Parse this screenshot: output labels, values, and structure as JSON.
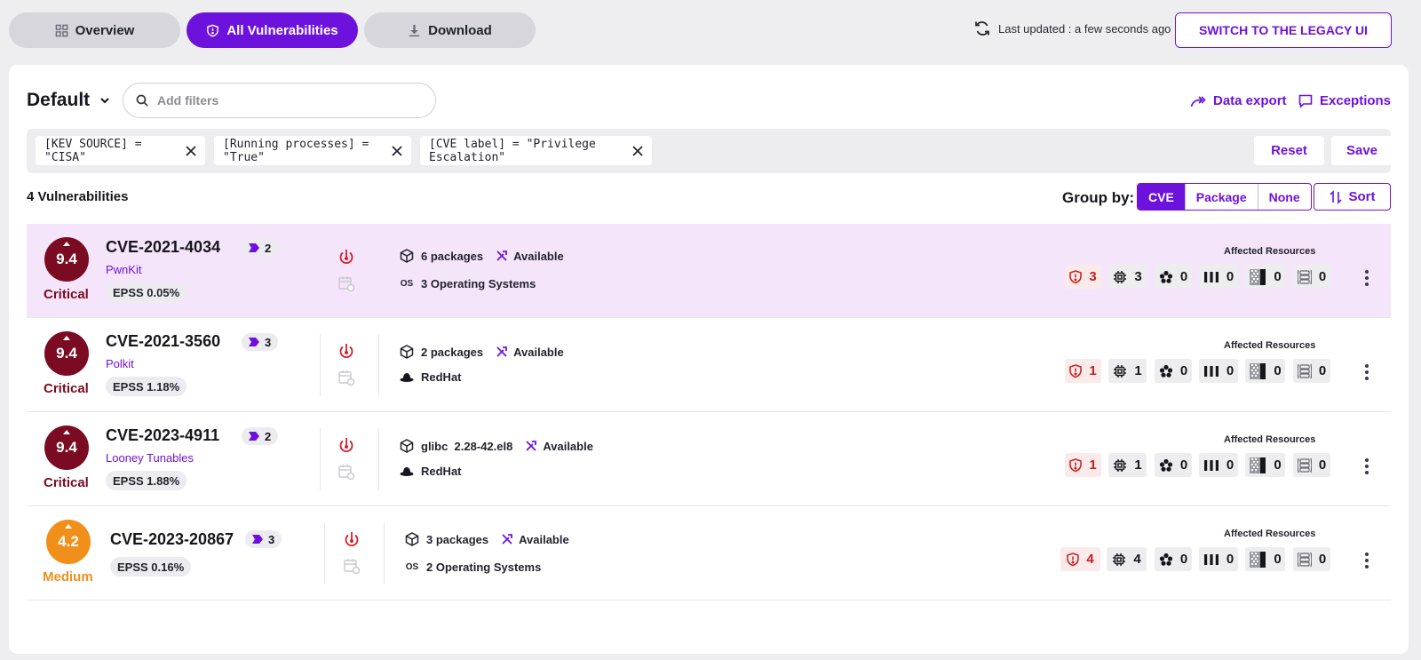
{
  "nav": {
    "overview_label": "Overview",
    "all_vulns_label": "All Vulnerabilities",
    "download_label": "Download",
    "last_updated": "Last updated : a few seconds ago",
    "legacy_label": "SWITCH TO THE LEGACY UI"
  },
  "toolbar": {
    "view_name": "Default",
    "search_placeholder": "Add filters",
    "data_export_label": "Data export",
    "exceptions_label": "Exceptions"
  },
  "filters": {
    "chips": [
      "[KEV SOURCE] = \"CISA\"",
      "[Running processes] = \"True\"",
      "[CVE label] = \"Privilege Escalation\""
    ],
    "reset_label": "Reset",
    "save_label": "Save"
  },
  "summary": {
    "count_label": "4 Vulnerabilities",
    "group_by_label": "Group by:",
    "group_options": [
      "CVE",
      "Package",
      "None"
    ],
    "group_selected": "CVE",
    "sort_label": "Sort"
  },
  "colors": {
    "accent": "#6d12dc",
    "critical": "#7a0b22",
    "medium": "#f0901a",
    "highlight_row": "#f5e5fb"
  },
  "affected_label": "Affected Resources",
  "rows": [
    {
      "score": "9.4",
      "severity": "Critical",
      "cve": "CVE-2021-4034",
      "tag_count": "2",
      "alias": "PwnKit",
      "epss": "EPSS 0.05%",
      "packages": "6 packages",
      "fix": "Available",
      "os_prefix": "OS",
      "os": "3 Operating Systems",
      "counts": [
        "3",
        "3",
        "0",
        "0",
        "0",
        "0"
      ]
    },
    {
      "score": "9.4",
      "severity": "Critical",
      "cve": "CVE-2021-3560",
      "tag_count": "3",
      "alias": "Polkit",
      "epss": "EPSS 1.18%",
      "packages": "2 packages",
      "fix": "Available",
      "os": "RedHat",
      "counts": [
        "1",
        "1",
        "0",
        "0",
        "0",
        "0"
      ]
    },
    {
      "score": "9.4",
      "severity": "Critical",
      "cve": "CVE-2023-4911",
      "tag_count": "2",
      "alias": "Looney Tunables",
      "epss": "EPSS 1.88%",
      "packages": "glibc  2.28-42.el8",
      "fix": "Available",
      "os": "RedHat",
      "counts": [
        "1",
        "1",
        "0",
        "0",
        "0",
        "0"
      ]
    },
    {
      "score": "4.2",
      "severity": "Medium",
      "cve": "CVE-2023-20867",
      "tag_count": "3",
      "epss": "EPSS 0.16%",
      "packages": "3 packages",
      "fix": "Available",
      "os_prefix": "OS",
      "os": "2 Operating Systems",
      "counts": [
        "4",
        "4",
        "0",
        "0",
        "0",
        "0"
      ]
    }
  ]
}
